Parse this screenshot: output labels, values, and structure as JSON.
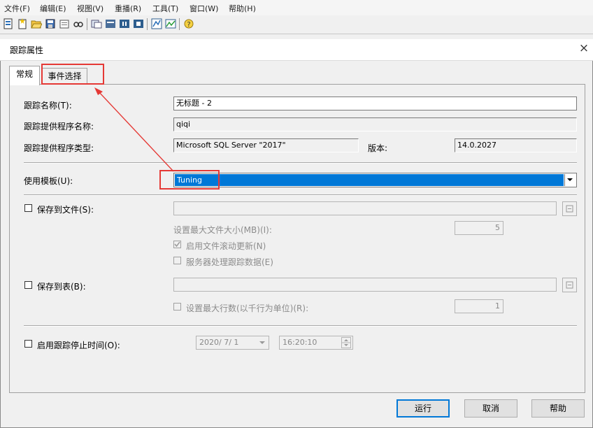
{
  "menubar": {
    "items": [
      "文件(F)",
      "编辑(E)",
      "视图(V)",
      "重播(R)",
      "工具(T)",
      "窗口(W)",
      "帮助(H)"
    ]
  },
  "toolbar": {
    "icons": [
      "new-trace-icon",
      "new-template-icon",
      "open-icon",
      "save-icon",
      "properties-icon",
      "find-icon",
      "extract-icon",
      "clear-icon",
      "pause-icon",
      "stop-icon",
      "trace-window-icon",
      "perfmon-icon",
      "help-icon"
    ]
  },
  "dialog": {
    "title": "跟踪属性",
    "close": "×",
    "tabs": [
      "常规",
      "事件选择"
    ]
  },
  "general": {
    "trace_name_label": "跟踪名称(T):",
    "trace_name_value": "无标题 - 2",
    "provider_name_label": "跟踪提供程序名称:",
    "provider_name_value": "qiqi",
    "provider_type_label": "跟踪提供程序类型:",
    "provider_type_value": "Microsoft SQL Server \"2017\"",
    "version_label": "版本:",
    "version_value": "14.0.2027",
    "template_label": "使用模板(U):",
    "template_value": "Tuning",
    "save_to_file_label": "保存到文件(S):",
    "max_file_size_label": "设置最大文件大小(MB)(I):",
    "max_file_size_value": "5",
    "file_rollover_label": "启用文件滚动更新(N)",
    "server_process_label": "服务器处理跟踪数据(E)",
    "save_to_table_label": "保存到表(B):",
    "max_rows_label": "设置最大行数(以千行为单位)(R):",
    "max_rows_value": "1",
    "stop_time_label": "启用跟踪停止时间(O):",
    "stop_date_value": "2020/ 7/ 1",
    "stop_time_value": "16:20:10"
  },
  "buttons": {
    "run": "运行",
    "cancel": "取消",
    "help": "帮助"
  },
  "colors": {
    "selection": "#0078d7",
    "annotation": "#e53935"
  }
}
